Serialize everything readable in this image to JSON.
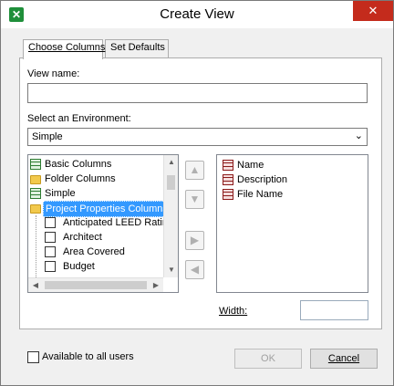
{
  "window": {
    "title": "Create View",
    "close_glyph": "✕",
    "icon": "app-icon"
  },
  "tabs": [
    {
      "label": "Choose Columns",
      "active": true
    },
    {
      "label": "Set Defaults",
      "active": false
    }
  ],
  "view_name": {
    "label": "View name:",
    "value": ""
  },
  "environment": {
    "label": "Select an Environment:",
    "selected": "Simple"
  },
  "available_tree": [
    {
      "label": "Basic Columns",
      "icon": "grid-icon",
      "checkbox": false
    },
    {
      "label": "Folder Columns",
      "icon": "folder-icon",
      "checkbox": false
    },
    {
      "label": "Simple",
      "icon": "grid-icon",
      "checkbox": false
    },
    {
      "label": "Project Properties Columns",
      "icon": "folder-star-icon",
      "checkbox": false,
      "selected": true
    },
    {
      "label": "Anticipated LEED Ratin",
      "checkbox": true
    },
    {
      "label": "Architect",
      "checkbox": true
    },
    {
      "label": "Area Covered",
      "checkbox": true
    },
    {
      "label": "Budget",
      "checkbox": true
    }
  ],
  "selected_columns": [
    {
      "label": "Name",
      "icon": "grid-icon"
    },
    {
      "label": "Description",
      "icon": "grid-icon"
    },
    {
      "label": "File Name",
      "icon": "grid-icon"
    }
  ],
  "move_buttons": {
    "up": "▲",
    "down": "▼",
    "add": "▶",
    "remove": "◀"
  },
  "width": {
    "label": "Width:",
    "value": ""
  },
  "available_to_all": {
    "label": "Available to all users",
    "checked": false
  },
  "buttons": {
    "ok": "OK",
    "cancel": "Cancel"
  }
}
